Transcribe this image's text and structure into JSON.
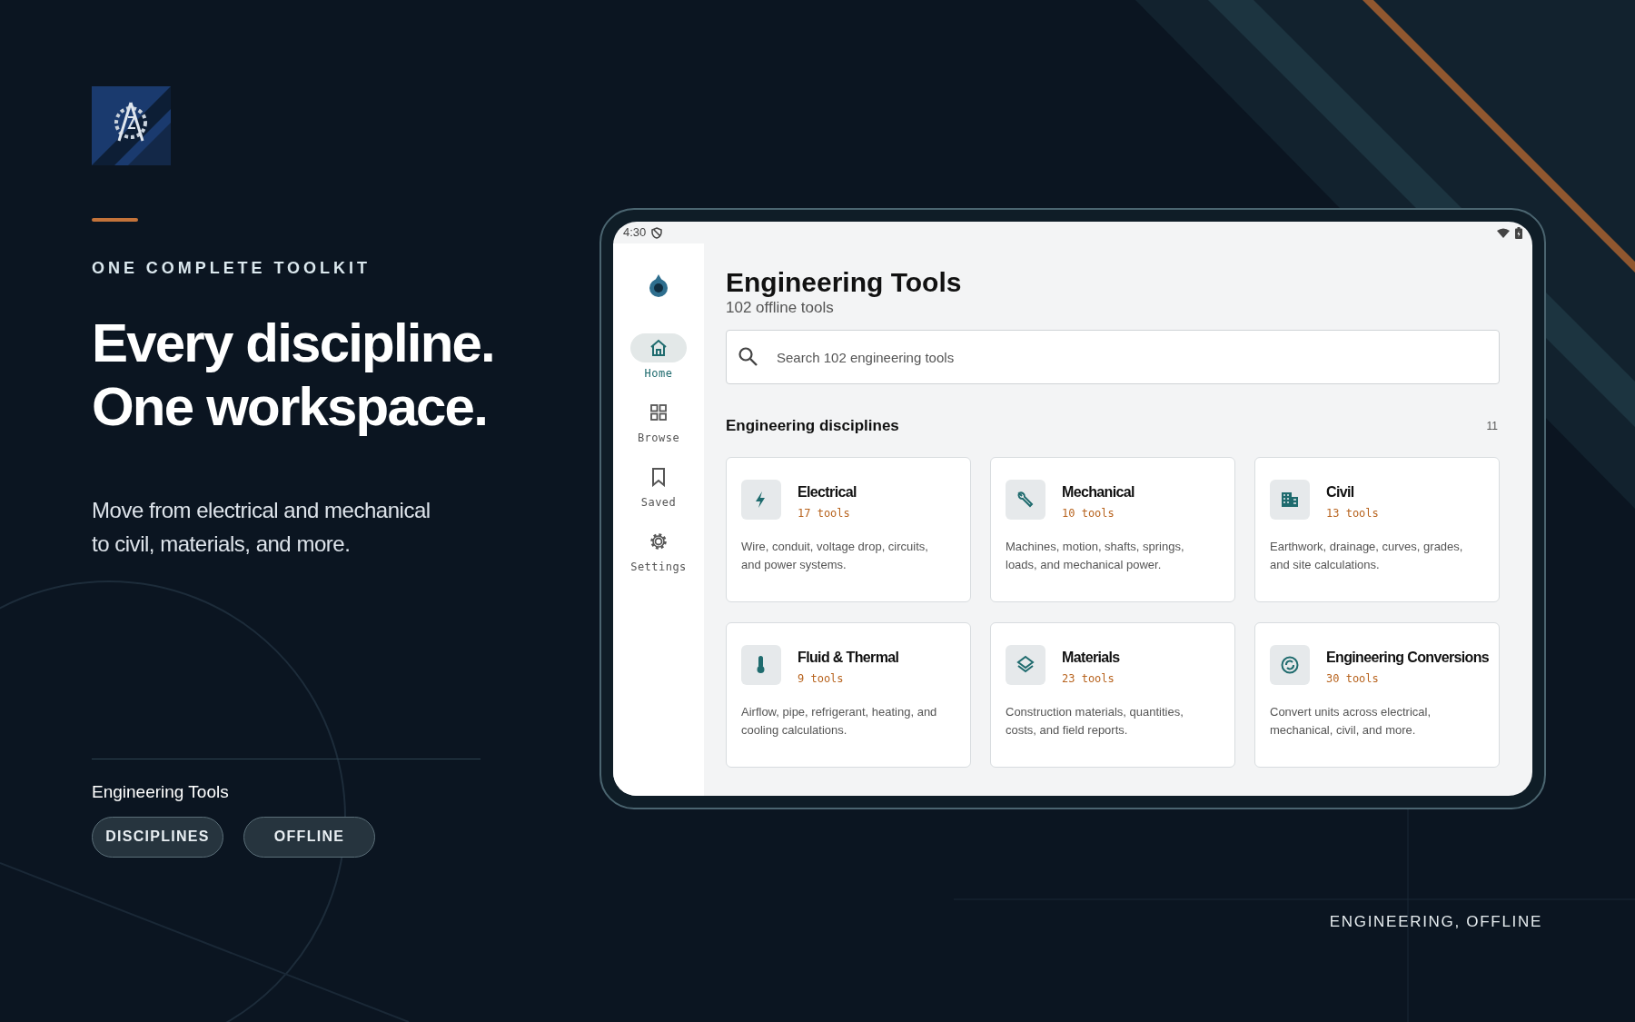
{
  "hero": {
    "eyebrow": "ONE COMPLETE TOOLKIT",
    "headline": [
      "Every discipline.",
      "One workspace."
    ],
    "body": "Move from electrical and mechanical to civil, materials, and more.",
    "app_name": "Engineering Tools",
    "tags": [
      "DISCIPLINES",
      "OFFLINE"
    ],
    "footer": "ENGINEERING, OFFLINE"
  },
  "tablet": {
    "status_bar": {
      "time": "4:30"
    },
    "nav": [
      {
        "label": "Home",
        "selected": true
      },
      {
        "label": "Browse",
        "selected": false
      },
      {
        "label": "Saved",
        "selected": false
      },
      {
        "label": "Settings",
        "selected": false
      }
    ],
    "title": "Engineering Tools",
    "subtitle": "102 offline tools",
    "search": {
      "placeholder": "Search 102 engineering tools"
    },
    "section": {
      "title": "Engineering disciplines",
      "count": "11"
    },
    "cards": [
      {
        "title": "Electrical",
        "count": "17 tools",
        "description": "Wire, conduit, voltage drop, circuits, and power systems."
      },
      {
        "title": "Mechanical",
        "count": "10 tools",
        "description": "Machines, motion, shafts, springs, loads, and mechanical power."
      },
      {
        "title": "Civil",
        "count": "13 tools",
        "description": "Earthwork, drainage, curves, grades, and site calculations."
      },
      {
        "title": "Fluid & Thermal",
        "count": "9 tools",
        "description": "Airflow, pipe, refrigerant, heating, and cooling calculations."
      },
      {
        "title": "Materials",
        "count": "23 tools",
        "description": "Construction materials, quantities, costs, and field reports."
      },
      {
        "title": "Engineering Conversions",
        "count": "30 tools",
        "description": "Convert units across electrical, mechanical, civil, and more."
      }
    ]
  }
}
